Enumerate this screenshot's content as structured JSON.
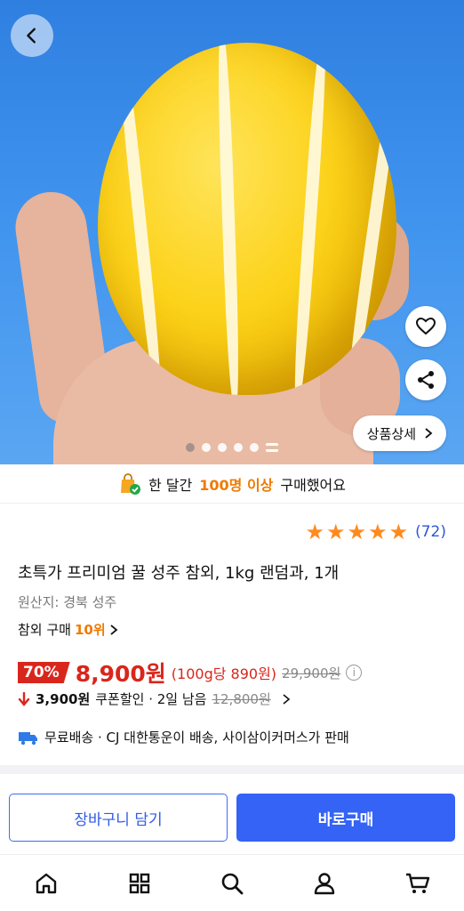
{
  "hero": {
    "detail_button": "상품상세",
    "page_count": 6,
    "active_page": 6
  },
  "banner": {
    "pre": "한 달간",
    "highlight": "100명 이상",
    "post": "구매했어요"
  },
  "rating": {
    "stars": 5,
    "count": "(72)"
  },
  "product": {
    "title": "초특가 프리미엄 꿀 성주 참외, 1kg 랜덤과, 1개",
    "origin": "원산지: 경북 성주",
    "rank_label": "참외 구매",
    "rank_value": "10위"
  },
  "price": {
    "discount": "70%",
    "sale_price": "8,900원",
    "unit_price": "(100g당 890원)",
    "original_price": "29,900원"
  },
  "coupon": {
    "amount": "3,900원",
    "label": "쿠폰할인 · 2일 남음",
    "price_before": "12,800원"
  },
  "shipping": {
    "text": "무료배송 · CJ 대한통운이 배송, 사이삼이커머스가 판매"
  },
  "actions": {
    "cart": "장바구니 담기",
    "buy": "바로구매"
  },
  "colors": {
    "accent_orange": "#f07a00",
    "price_red": "#d9261c",
    "primary_blue": "#3563f5",
    "star": "#ff8a1f"
  },
  "tabs": [
    {
      "icon": "home-icon"
    },
    {
      "icon": "grid-icon"
    },
    {
      "icon": "search-icon"
    },
    {
      "icon": "user-icon"
    },
    {
      "icon": "cart-icon"
    }
  ]
}
